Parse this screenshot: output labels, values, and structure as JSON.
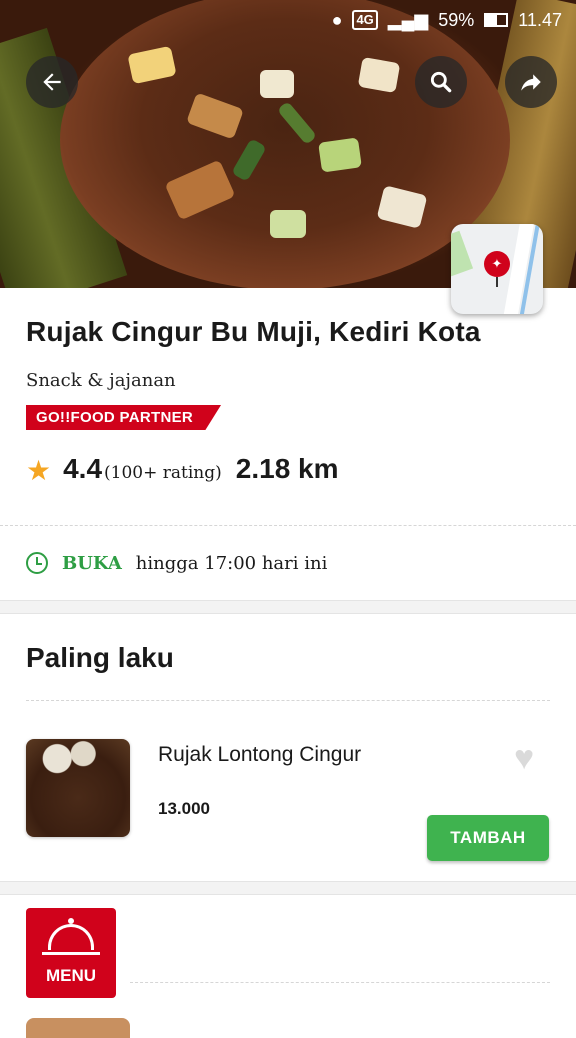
{
  "status_bar": {
    "network": "4G",
    "battery": "59%",
    "time": "11.47"
  },
  "hero": {
    "back_icon": "arrow-left-icon",
    "search_icon": "search-icon",
    "share_icon": "share-icon",
    "map_icon": "map-pin-icon"
  },
  "restaurant": {
    "name": "Rujak Cingur Bu Muji, Kediri Kota",
    "category": "Snack & jajanan",
    "partner_badge": "GO!!FOOD PARTNER",
    "rating": "4.4",
    "rating_count": "(100+ rating)",
    "distance": "2.18 km",
    "open_status": "BUKA",
    "open_hours": "hingga 17:00 hari ini"
  },
  "bestseller": {
    "title": "Paling laku",
    "items": [
      {
        "name": "Rujak Lontong Cingur",
        "price": "13.000",
        "add_label": "TAMBAH"
      }
    ]
  },
  "menu_button": {
    "label": "MENU"
  },
  "colors": {
    "brand_red": "#d0021b",
    "open_green": "#2e9e44",
    "add_green": "#3fb34f",
    "star": "#f5a623"
  }
}
